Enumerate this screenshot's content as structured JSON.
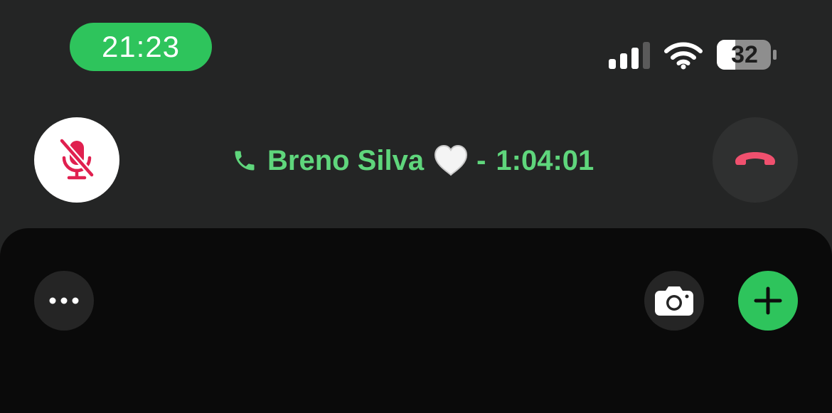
{
  "status_bar": {
    "time": "21:23",
    "battery_level": "32",
    "signal_bars_active": 3,
    "signal_bars_total": 4,
    "icons": [
      "signal-icon",
      "wifi-icon",
      "battery-icon"
    ]
  },
  "call": {
    "contact_name": "Breno Silva",
    "separator": "-",
    "duration": "1:04:01",
    "muted": true,
    "icons": [
      "phone-icon",
      "white-heart-icon"
    ]
  },
  "controls": {
    "mute_icon": "mic-slash-icon",
    "end_call_icon": "phone-down-icon",
    "more_icon": "ellipsis-icon",
    "camera_icon": "camera-icon",
    "add_icon": "plus-icon"
  },
  "colors": {
    "accent_green": "#2ec45c",
    "call_text_green": "#5fd67c",
    "end_call_red": "#f0506e",
    "mute_red": "#e0204f",
    "background": "#242525",
    "panel": "#0a0a0a"
  }
}
